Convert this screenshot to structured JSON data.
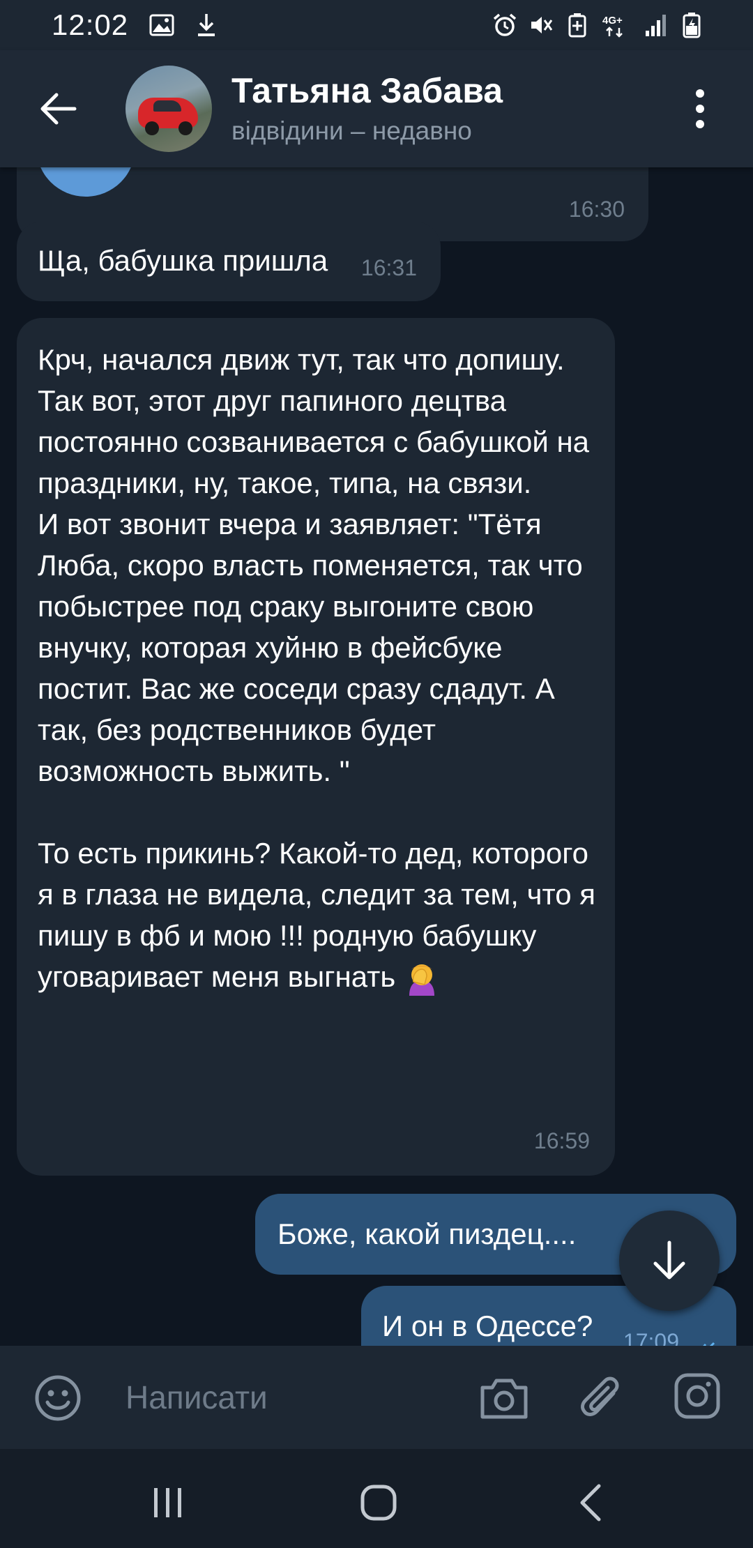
{
  "status_bar": {
    "time": "12:02",
    "network": "4G+"
  },
  "header": {
    "chat_name": "Татьяна Забава",
    "chat_status": "відвідини – недавно"
  },
  "messages": [
    {
      "direction": "in",
      "type": "photo",
      "time": "16:30"
    },
    {
      "direction": "in",
      "text": "Ща, бабушка пришла",
      "time": "16:31"
    },
    {
      "direction": "in",
      "text": "Крч, начался движ тут, так что допишу.\nТак вот, этот друг папиного децтва постоянно созванивается с бабушкой на праздники, ну, такое, типа, на связи.\nИ вот звонит вчера и заявляет: \"Тётя Люба, скоро власть поменяется, так что побыстрее под сраку выгоните свою внучку, которая хуйню в фейсбуке постит. Вас же соседи сразу сдадут. А так, без родственников будет возможность выжить. \"\n\nТо есть прикинь? Какой-то дед, которого я в глаза не видела, следит за тем, что я пишу в фб и мою !!! родную бабушку уговаривает меня выгнать",
      "emoji": "face-palm-emoji",
      "time": "16:59"
    },
    {
      "direction": "out",
      "text": "Боже, какой пиздец....",
      "read": true
    },
    {
      "direction": "out",
      "text": "И он в Одессе?",
      "time": "17:09",
      "read": true
    }
  ],
  "input": {
    "placeholder": "Написати"
  },
  "icons": {
    "back": "arrow-left-icon",
    "menu": "more-vertical-icon",
    "scroll_down": "arrow-down-icon",
    "emoji": "smile-icon",
    "camera": "camera-icon",
    "attach": "paperclip-icon",
    "instagram": "instagram-icon"
  },
  "colors": {
    "background": "#0e1621",
    "header": "#1f2936",
    "incoming_bubble": "#1d2733",
    "outgoing_bubble": "#2b5278",
    "read_check": "#5fb2f0"
  }
}
